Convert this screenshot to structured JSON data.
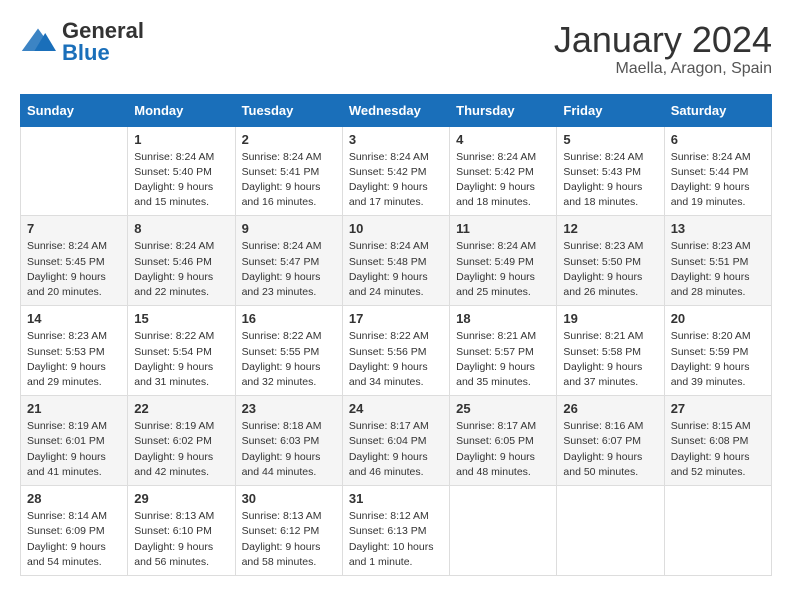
{
  "header": {
    "logo": {
      "general": "General",
      "blue": "Blue"
    },
    "title": "January 2024",
    "subtitle": "Maella, Aragon, Spain"
  },
  "columns": [
    "Sunday",
    "Monday",
    "Tuesday",
    "Wednesday",
    "Thursday",
    "Friday",
    "Saturday"
  ],
  "weeks": [
    [
      {
        "day": null,
        "sunrise": null,
        "sunset": null,
        "daylight": null
      },
      {
        "day": "1",
        "sunrise": "Sunrise: 8:24 AM",
        "sunset": "Sunset: 5:40 PM",
        "daylight": "Daylight: 9 hours and 15 minutes."
      },
      {
        "day": "2",
        "sunrise": "Sunrise: 8:24 AM",
        "sunset": "Sunset: 5:41 PM",
        "daylight": "Daylight: 9 hours and 16 minutes."
      },
      {
        "day": "3",
        "sunrise": "Sunrise: 8:24 AM",
        "sunset": "Sunset: 5:42 PM",
        "daylight": "Daylight: 9 hours and 17 minutes."
      },
      {
        "day": "4",
        "sunrise": "Sunrise: 8:24 AM",
        "sunset": "Sunset: 5:42 PM",
        "daylight": "Daylight: 9 hours and 18 minutes."
      },
      {
        "day": "5",
        "sunrise": "Sunrise: 8:24 AM",
        "sunset": "Sunset: 5:43 PM",
        "daylight": "Daylight: 9 hours and 18 minutes."
      },
      {
        "day": "6",
        "sunrise": "Sunrise: 8:24 AM",
        "sunset": "Sunset: 5:44 PM",
        "daylight": "Daylight: 9 hours and 19 minutes."
      }
    ],
    [
      {
        "day": "7",
        "sunrise": "Sunrise: 8:24 AM",
        "sunset": "Sunset: 5:45 PM",
        "daylight": "Daylight: 9 hours and 20 minutes."
      },
      {
        "day": "8",
        "sunrise": "Sunrise: 8:24 AM",
        "sunset": "Sunset: 5:46 PM",
        "daylight": "Daylight: 9 hours and 22 minutes."
      },
      {
        "day": "9",
        "sunrise": "Sunrise: 8:24 AM",
        "sunset": "Sunset: 5:47 PM",
        "daylight": "Daylight: 9 hours and 23 minutes."
      },
      {
        "day": "10",
        "sunrise": "Sunrise: 8:24 AM",
        "sunset": "Sunset: 5:48 PM",
        "daylight": "Daylight: 9 hours and 24 minutes."
      },
      {
        "day": "11",
        "sunrise": "Sunrise: 8:24 AM",
        "sunset": "Sunset: 5:49 PM",
        "daylight": "Daylight: 9 hours and 25 minutes."
      },
      {
        "day": "12",
        "sunrise": "Sunrise: 8:23 AM",
        "sunset": "Sunset: 5:50 PM",
        "daylight": "Daylight: 9 hours and 26 minutes."
      },
      {
        "day": "13",
        "sunrise": "Sunrise: 8:23 AM",
        "sunset": "Sunset: 5:51 PM",
        "daylight": "Daylight: 9 hours and 28 minutes."
      }
    ],
    [
      {
        "day": "14",
        "sunrise": "Sunrise: 8:23 AM",
        "sunset": "Sunset: 5:53 PM",
        "daylight": "Daylight: 9 hours and 29 minutes."
      },
      {
        "day": "15",
        "sunrise": "Sunrise: 8:22 AM",
        "sunset": "Sunset: 5:54 PM",
        "daylight": "Daylight: 9 hours and 31 minutes."
      },
      {
        "day": "16",
        "sunrise": "Sunrise: 8:22 AM",
        "sunset": "Sunset: 5:55 PM",
        "daylight": "Daylight: 9 hours and 32 minutes."
      },
      {
        "day": "17",
        "sunrise": "Sunrise: 8:22 AM",
        "sunset": "Sunset: 5:56 PM",
        "daylight": "Daylight: 9 hours and 34 minutes."
      },
      {
        "day": "18",
        "sunrise": "Sunrise: 8:21 AM",
        "sunset": "Sunset: 5:57 PM",
        "daylight": "Daylight: 9 hours and 35 minutes."
      },
      {
        "day": "19",
        "sunrise": "Sunrise: 8:21 AM",
        "sunset": "Sunset: 5:58 PM",
        "daylight": "Daylight: 9 hours and 37 minutes."
      },
      {
        "day": "20",
        "sunrise": "Sunrise: 8:20 AM",
        "sunset": "Sunset: 5:59 PM",
        "daylight": "Daylight: 9 hours and 39 minutes."
      }
    ],
    [
      {
        "day": "21",
        "sunrise": "Sunrise: 8:19 AM",
        "sunset": "Sunset: 6:01 PM",
        "daylight": "Daylight: 9 hours and 41 minutes."
      },
      {
        "day": "22",
        "sunrise": "Sunrise: 8:19 AM",
        "sunset": "Sunset: 6:02 PM",
        "daylight": "Daylight: 9 hours and 42 minutes."
      },
      {
        "day": "23",
        "sunrise": "Sunrise: 8:18 AM",
        "sunset": "Sunset: 6:03 PM",
        "daylight": "Daylight: 9 hours and 44 minutes."
      },
      {
        "day": "24",
        "sunrise": "Sunrise: 8:17 AM",
        "sunset": "Sunset: 6:04 PM",
        "daylight": "Daylight: 9 hours and 46 minutes."
      },
      {
        "day": "25",
        "sunrise": "Sunrise: 8:17 AM",
        "sunset": "Sunset: 6:05 PM",
        "daylight": "Daylight: 9 hours and 48 minutes."
      },
      {
        "day": "26",
        "sunrise": "Sunrise: 8:16 AM",
        "sunset": "Sunset: 6:07 PM",
        "daylight": "Daylight: 9 hours and 50 minutes."
      },
      {
        "day": "27",
        "sunrise": "Sunrise: 8:15 AM",
        "sunset": "Sunset: 6:08 PM",
        "daylight": "Daylight: 9 hours and 52 minutes."
      }
    ],
    [
      {
        "day": "28",
        "sunrise": "Sunrise: 8:14 AM",
        "sunset": "Sunset: 6:09 PM",
        "daylight": "Daylight: 9 hours and 54 minutes."
      },
      {
        "day": "29",
        "sunrise": "Sunrise: 8:13 AM",
        "sunset": "Sunset: 6:10 PM",
        "daylight": "Daylight: 9 hours and 56 minutes."
      },
      {
        "day": "30",
        "sunrise": "Sunrise: 8:13 AM",
        "sunset": "Sunset: 6:12 PM",
        "daylight": "Daylight: 9 hours and 58 minutes."
      },
      {
        "day": "31",
        "sunrise": "Sunrise: 8:12 AM",
        "sunset": "Sunset: 6:13 PM",
        "daylight": "Daylight: 10 hours and 1 minute."
      },
      {
        "day": null,
        "sunrise": null,
        "sunset": null,
        "daylight": null
      },
      {
        "day": null,
        "sunrise": null,
        "sunset": null,
        "daylight": null
      },
      {
        "day": null,
        "sunrise": null,
        "sunset": null,
        "daylight": null
      }
    ]
  ]
}
